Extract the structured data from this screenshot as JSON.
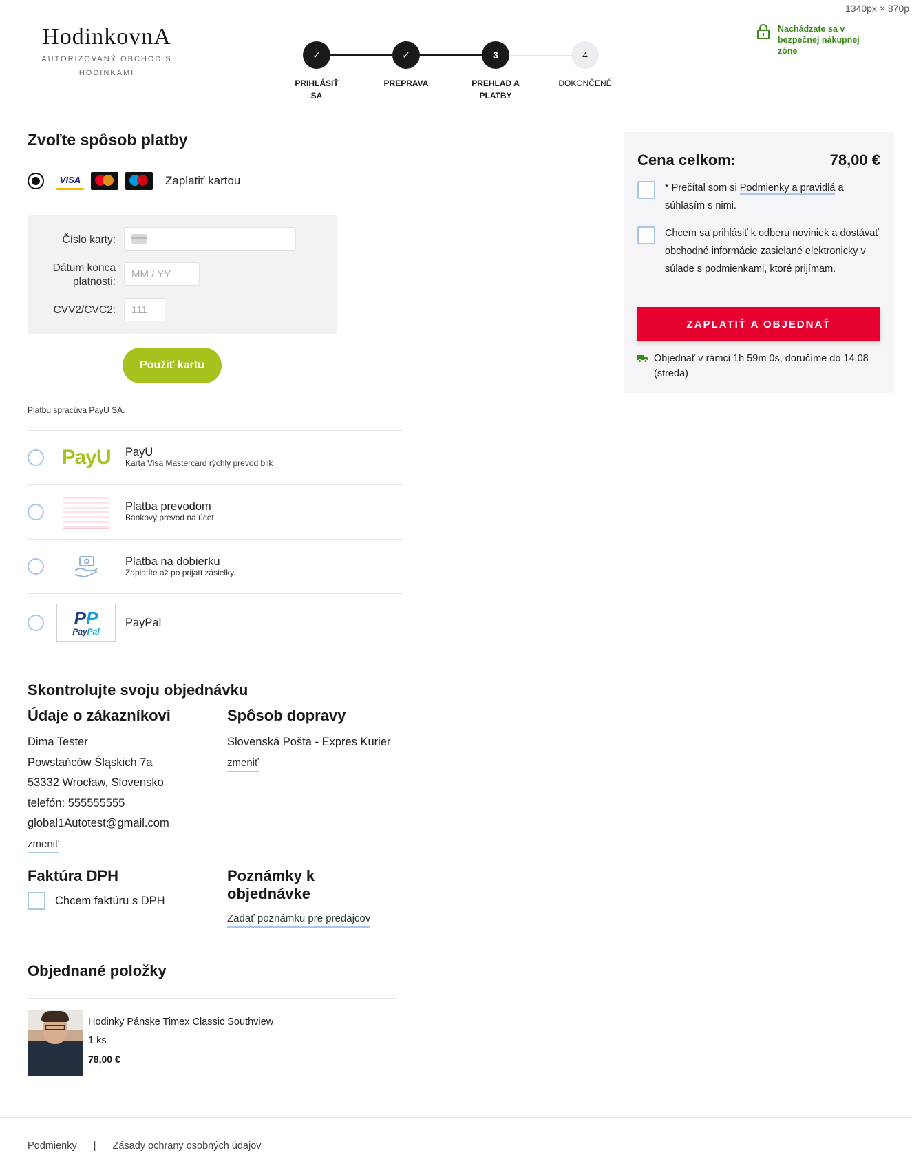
{
  "viewport_label": "1340px × 870p",
  "brand": {
    "name": "HodinkovnA",
    "tagline": "AUTORIZOVANÝ OBCHOD S HODINKAMI"
  },
  "steps": [
    {
      "num": "✓",
      "label": "PRIHLÁSIŤ SA",
      "state": "done"
    },
    {
      "num": "✓",
      "label": "PREPRAVA",
      "state": "done"
    },
    {
      "num": "3",
      "label": "PREHĽAD A PLATBY",
      "state": "current"
    },
    {
      "num": "4",
      "label": "DOKONČENÉ",
      "state": "todo"
    }
  ],
  "secure_zone": {
    "text": "Nachádzate sa v bezpečnej nákupnej zóne",
    "color": "#3a8a1a"
  },
  "payment": {
    "title": "Zvoľte spôsob platby",
    "card_option_label": "Zaplatiť kartou",
    "card_brands": [
      "VISA",
      "mastercard",
      "maestro"
    ],
    "form": {
      "card_number_label": "Číslo karty:",
      "expiry_label": "Dátum konca platnosti:",
      "expiry_placeholder": "MM / YY",
      "cvv_label": "CVV2/CVC2:",
      "cvv_placeholder": "111"
    },
    "use_card_button": "Použiť kartu",
    "processor_note": "Platbu spracúva PayU SA.",
    "methods": [
      {
        "id": "payu",
        "name": "PayU",
        "desc": "Karta Visa Mastercard rýchly prevod blik",
        "logo_text": "PayU"
      },
      {
        "id": "transfer",
        "name": "Platba prevodom",
        "desc": "Bankový prevod na účet"
      },
      {
        "id": "cod",
        "name": "Platba na dobierku",
        "desc": "Zaplatíte až po prijatí zásielky."
      },
      {
        "id": "paypal",
        "name": "PayPal",
        "desc": "",
        "logo_text": "PayPal"
      }
    ]
  },
  "review": {
    "title": "Skontrolujte svoju objednávku",
    "customer": {
      "title": "Údaje o zákazníkovi",
      "name": "Dima Tester",
      "street": "Powstańców Śląskich 7a",
      "city": "53332 Wrocław, Slovensko",
      "phone": "telefón: 555555555",
      "email": "global1Autotest@gmail.com",
      "change": "zmeniť"
    },
    "shipping": {
      "title": "Spôsob dopravy",
      "method": "Slovenská Pošta - Expres Kurier",
      "change": "zmeniť"
    },
    "vat": {
      "title": "Faktúra DPH",
      "checkbox_label": "Chcem faktúru s DPH"
    },
    "notes": {
      "title": "Poznámky k objednávke",
      "link": "Zadať poznámku pre predajcov"
    }
  },
  "items": {
    "title": "Objednané položky",
    "list": [
      {
        "name": "Hodinky Pánske Timex Classic Southview",
        "qty": "1 ks",
        "price": "78,00 €"
      }
    ]
  },
  "summary": {
    "total_label": "Cena celkom:",
    "total_value": "78,00 €",
    "terms_prefix": "* Prečítal som si",
    "terms_link": "Podmienky a pravidlá",
    "terms_suffix": "a súhlasím s nimi.",
    "newsletter": "Chcem sa prihlásiť k odberu noviniek a dostávať obchodné informácie zasielané elektronicky v súlade s podmienkami, ktoré prijímam.",
    "pay_button": "ZAPLATIŤ A OBJEDNAŤ",
    "delivery_note": "Objednať v rámci 1h 59m 0s, doručíme do 14.08 (streda)",
    "pay_button_color": "#e7002f"
  },
  "footer": {
    "links": [
      "Podmienky",
      "|",
      "Zásady ochrany osobných údajov"
    ]
  }
}
